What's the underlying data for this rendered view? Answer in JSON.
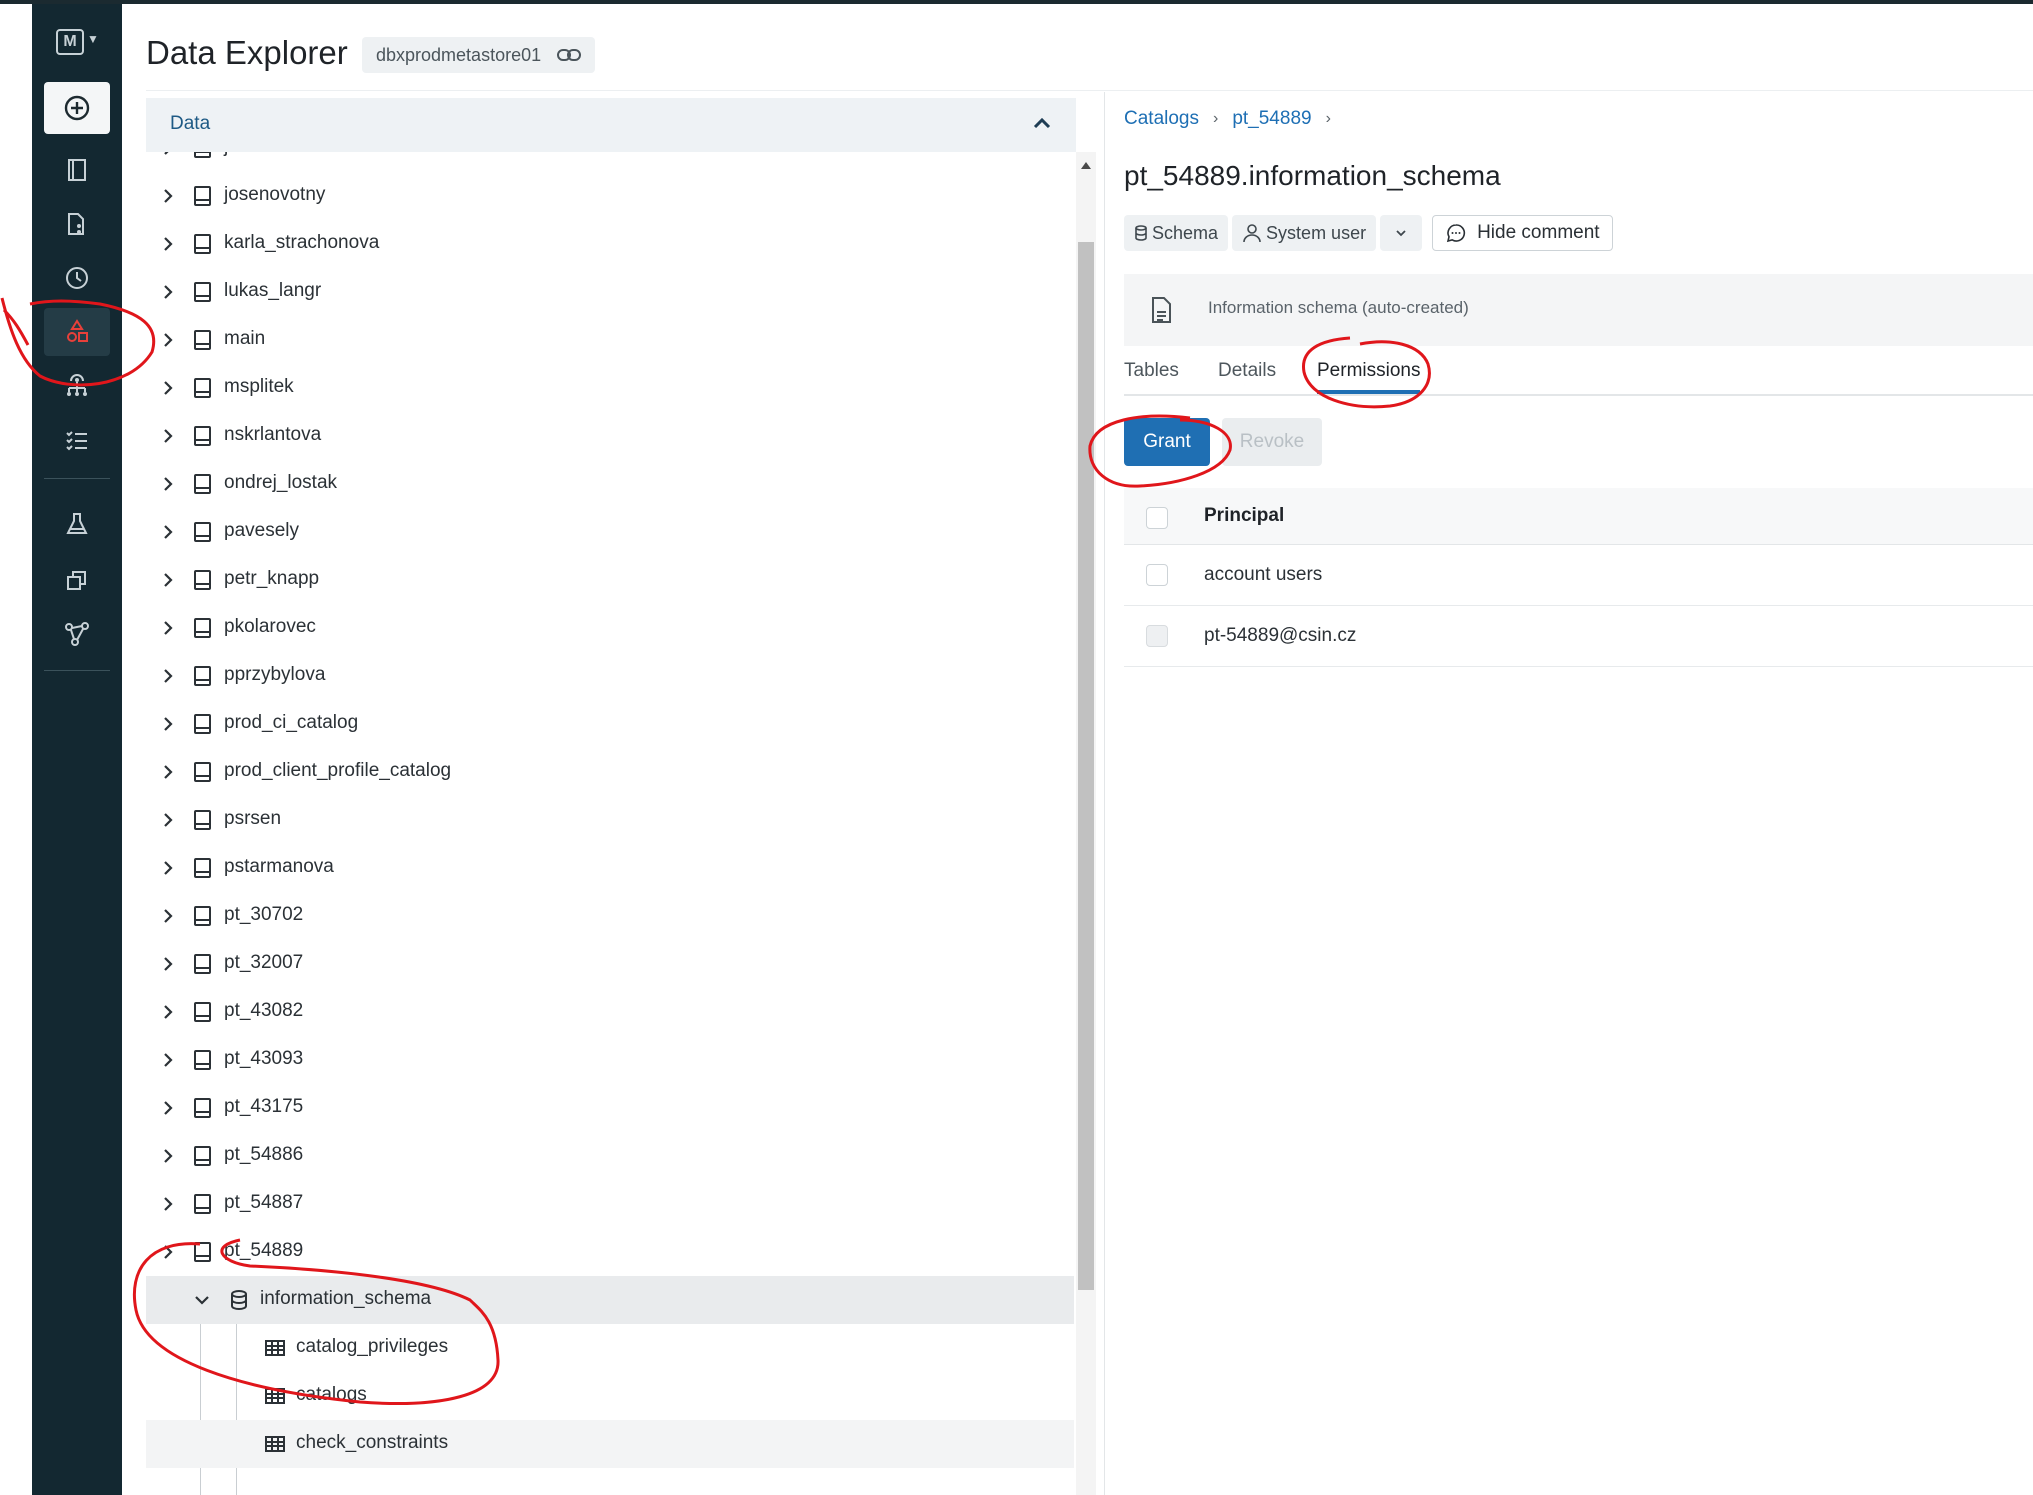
{
  "header": {
    "title": "Data Explorer",
    "metastore": "dbxprodmetastore01"
  },
  "rail": {
    "logo": "M",
    "items": [
      "new-icon",
      "workspace-icon",
      "repos-icon",
      "recents-icon",
      "data-icon",
      "workflows-icon",
      "compute-icon",
      "experiments-icon",
      "models-icon",
      "feature-store-icon"
    ]
  },
  "data_panel": {
    "header_label": "Data",
    "catalogs": [
      "jlzicar",
      "josenovotny",
      "karla_strachonova",
      "lukas_langr",
      "main",
      "msplitek",
      "nskrlantova",
      "ondrej_lostak",
      "pavesely",
      "petr_knapp",
      "pkolarovec",
      "pprzybylova",
      "prod_ci_catalog",
      "prod_client_profile_catalog",
      "psrsen",
      "pstarmanova",
      "pt_30702",
      "pt_32007",
      "pt_43082",
      "pt_43093",
      "pt_43175",
      "pt_54886",
      "pt_54887",
      "pt_54889"
    ],
    "schema": "information_schema",
    "tables": [
      "catalog_privileges",
      "catalogs",
      "check_constraints"
    ]
  },
  "detail": {
    "breadcrumb": [
      "Catalogs",
      "pt_54889"
    ],
    "title": "pt_54889.information_schema",
    "chips": {
      "type": "Schema",
      "owner": "System user",
      "hide_comment": "Hide comment"
    },
    "comment": "Information schema (auto-created)",
    "tabs": [
      "Tables",
      "Details",
      "Permissions"
    ],
    "active_tab": "Permissions",
    "buttons": {
      "grant": "Grant",
      "revoke": "Revoke"
    },
    "table": {
      "header": "Principal",
      "rows": [
        "account users",
        "pt-54889@csin.cz"
      ]
    }
  },
  "colors": {
    "rail_bg": "#132831",
    "accent": "#1f6fb3",
    "annotation": "#e0161b"
  }
}
